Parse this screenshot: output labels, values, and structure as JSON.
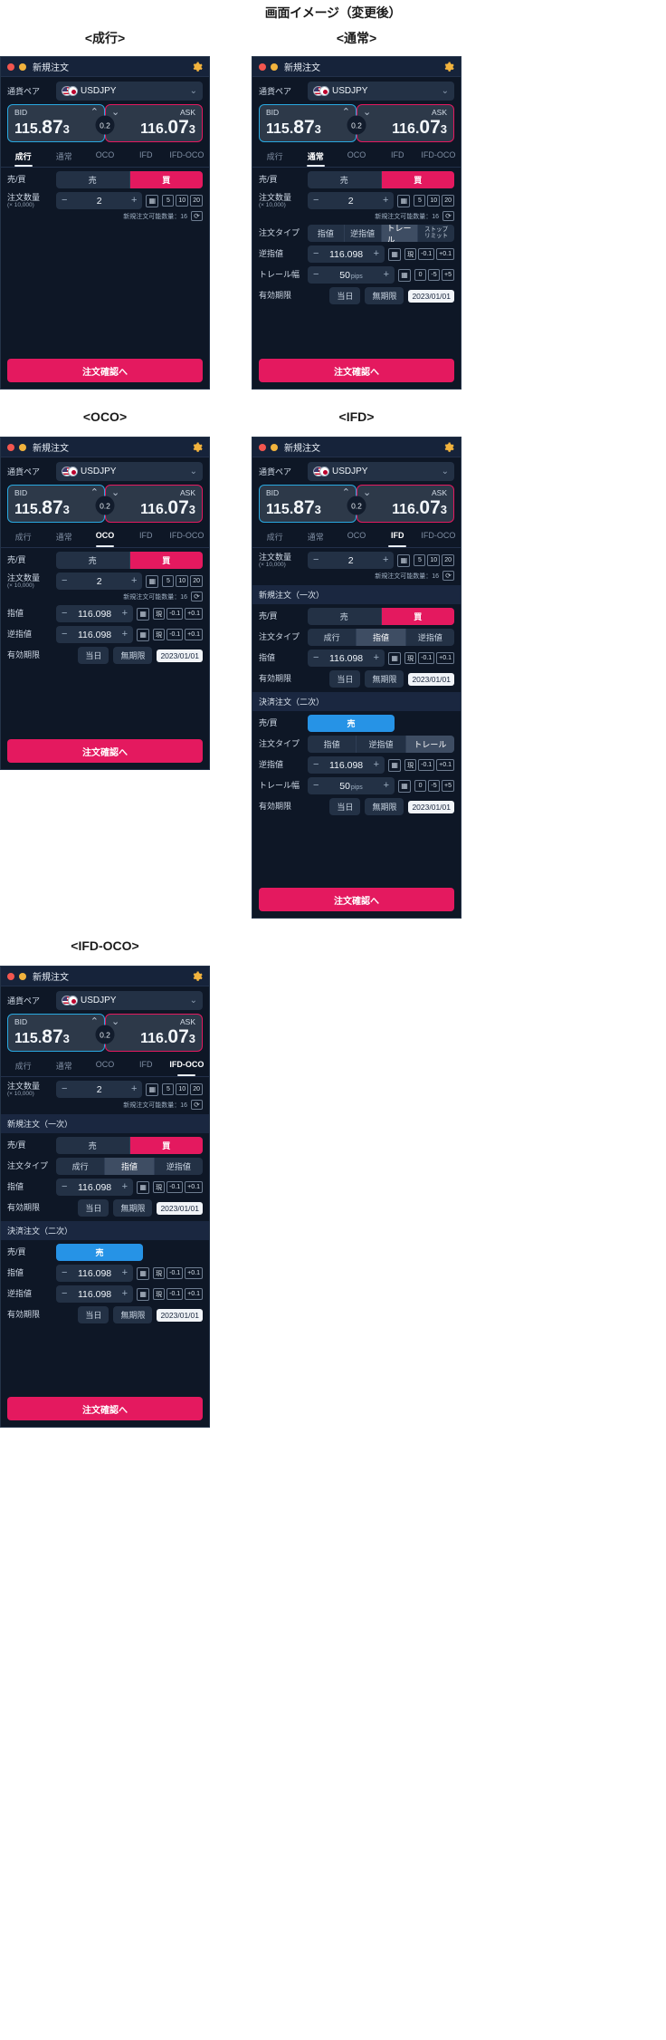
{
  "page": {
    "title": "画面イメージ（変更後）"
  },
  "common": {
    "window_title": "新規注文",
    "gear_icon": "gear-icon",
    "pair_label": "通貨ペア",
    "pair_value": "USDJPY",
    "pair_caret": "⌄",
    "bid_label": "BID",
    "ask_label": "ASK",
    "bid_price": {
      "p1": "115.",
      "p2": "87",
      "p3": "3"
    },
    "ask_price": {
      "p1": "116.",
      "p2": "07",
      "p3": "3"
    },
    "spread": "0.2",
    "bid_arrow": "⌃",
    "ask_arrow": "⌄",
    "tabs": [
      "成行",
      "通常",
      "OCO",
      "IFD",
      "IFD-OCO"
    ],
    "submit_label": "注文確認へ",
    "labels": {
      "side": "売/買",
      "qty": "注文数量",
      "qty_unit": "(× 10,000)",
      "order_type": "注文タイプ",
      "limit": "指値",
      "stop": "逆指値",
      "trail_width": "トレール幅",
      "expiry": "有効期限",
      "new_order_section": "新規注文（一次）",
      "close_order_section": "決済注文（二次）"
    },
    "side_options": {
      "sell": "売",
      "buy": "買"
    },
    "order_type_options": {
      "market": "成行",
      "limit": "指値",
      "stop": "逆指値",
      "trail": "トレール",
      "stop_limit": "ストップ\nリミット"
    },
    "qty_value": "2",
    "qty_minus": "−",
    "qty_plus": "+",
    "qty_presets": [
      "5",
      "10",
      "20"
    ],
    "calc_icon": "calculator-icon",
    "reload_icon": "reload-icon",
    "available_qty_text": "新規注文可能数量：16",
    "price_value": "116.098",
    "price_minus": "−",
    "price_plus": "+",
    "price_presets": [
      "-0.1",
      "+0.1"
    ],
    "price_now": "現",
    "trail_value": "50",
    "trail_unit": "pips",
    "trail_presets": [
      "0",
      "-5",
      "+5"
    ],
    "expiry_today": "当日",
    "expiry_none": "無期限",
    "expiry_date": "2023/01/01"
  },
  "panels": [
    {
      "caption": "<成行>",
      "key": "market",
      "active_tab": 0
    },
    {
      "caption": "<通常>",
      "key": "normal",
      "active_tab": 1
    },
    {
      "caption": "<OCO>",
      "key": "oco",
      "active_tab": 2
    },
    {
      "caption": "<IFD>",
      "key": "ifd",
      "active_tab": 3
    },
    {
      "caption": "<IFD-OCO>",
      "key": "ifdoco",
      "active_tab": 4
    }
  ]
}
